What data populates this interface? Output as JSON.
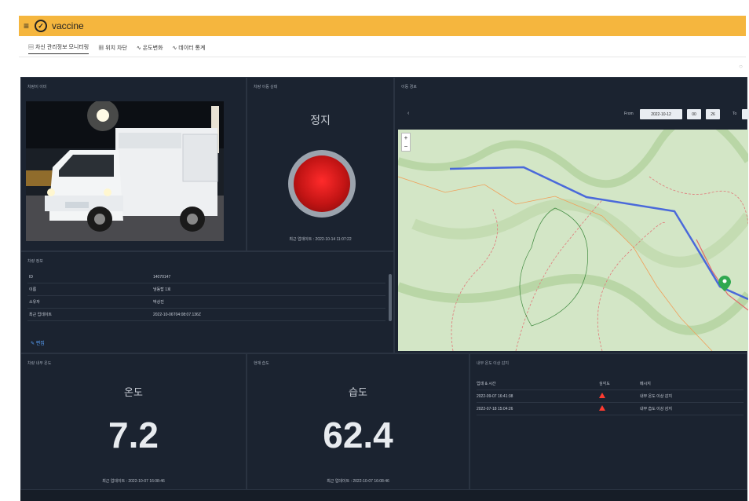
{
  "header": {
    "menu_icon": "≡",
    "logo_icon": "shield-check-icon",
    "app_title": "vaccine",
    "bar_color": "#f5b63e"
  },
  "tabs": [
    {
      "icon": "dashboard-icon",
      "label": "▤ 차신 관리정보 모니터링",
      "active": true
    },
    {
      "icon": "table-icon",
      "label": "▦ 위치 차단",
      "active": false
    },
    {
      "icon": "chart-icon",
      "label": "∿ 온도변화",
      "active": false
    },
    {
      "icon": "chart-icon",
      "label": "∿ 데이터 통계",
      "active": false
    }
  ],
  "panels": {
    "vehicle_photo": {
      "title": "차량이 이미",
      "alt_icon": "delivery-truck-image"
    },
    "operation_state": {
      "title": "차량 이동 상태",
      "state_label": "정지",
      "lamp_color": "#d11b1b",
      "last_update": "최근 업데이트 : 2022-10-14 11:07:22"
    },
    "route_map": {
      "title": "이동 경로",
      "back_label": "‹",
      "from_label": "From",
      "from_date": "2022-10-12",
      "from_hour": "00",
      "from_min": "26",
      "to_label": "To",
      "zoom_in": "+",
      "zoom_out": "−",
      "marker_icon": "map-pin-icon"
    },
    "vehicle_info": {
      "title": "차량 정보",
      "rows": [
        {
          "key": "ID",
          "value": "14070147"
        },
        {
          "key": "이름",
          "value": "냉동탑 1호"
        },
        {
          "key": "소유자",
          "value": "박상진"
        },
        {
          "key": "최근 업데이트",
          "value": "2022-10-06T04:08:07.136Z"
        }
      ],
      "edit_label": "✎ 편집"
    },
    "temperature": {
      "title": "차량 내부 온도",
      "label": "온도",
      "value": "7.2",
      "last_update": "최근 업데이트 : 2022-10-07 16:08:46"
    },
    "humidity": {
      "title": "현재 습도",
      "label": "습도",
      "value": "62.4",
      "last_update": "최근 업데이트 : 2022-10-07 16:08:46"
    },
    "alarm_log": {
      "title": "내부 온도 이상 감지",
      "columns": [
        "업데 & 시간",
        "심각도",
        "메시지"
      ],
      "rows": [
        {
          "time": "2022-09-07 16:41:38",
          "severity_icon": "warning-triangle-icon",
          "message": "내부 온도 이상 감지"
        },
        {
          "time": "2022-07-18 15:04:26",
          "severity_icon": "warning-triangle-icon",
          "message": "내부 습도 이상 감지"
        }
      ]
    }
  },
  "colors": {
    "dashboard_bg": "#161d27",
    "panel_bg": "#1b2330",
    "route_line": "#3b5bdb",
    "alert": "#ff3b30",
    "marker": "#2fa84f"
  }
}
